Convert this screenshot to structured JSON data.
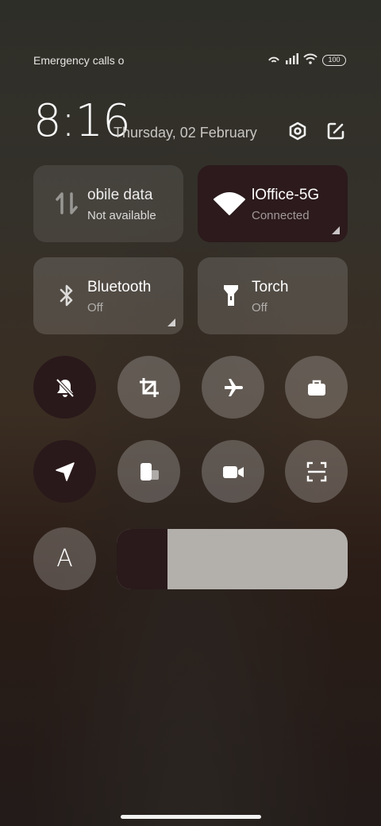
{
  "status_bar": {
    "carrier_text": "Emergency calls o",
    "battery_level": "100",
    "icons": [
      "hotspot-icon",
      "signal-icon",
      "wifi-icon",
      "battery-icon"
    ]
  },
  "header": {
    "time": "8:16",
    "date": "Thursday, 02 February",
    "actions": [
      "settings-icon",
      "edit-icon"
    ]
  },
  "tiles": {
    "mobile_data": {
      "title": "obile data",
      "subtitle": "Not available",
      "icon": "mobile-data-icon",
      "state": "unavailable"
    },
    "wifi": {
      "title": "lOffice-5G",
      "subtitle": "Connected",
      "icon": "wifi-icon",
      "state": "on"
    },
    "bluetooth": {
      "title": "Bluetooth",
      "subtitle": "Off",
      "icon": "bluetooth-icon",
      "state": "off"
    },
    "torch": {
      "title": "Torch",
      "subtitle": "Off",
      "icon": "flashlight-icon",
      "state": "off"
    }
  },
  "toggles": [
    {
      "name": "mute",
      "icon": "bell-off-icon",
      "state": "on"
    },
    {
      "name": "screenshot",
      "icon": "crop-icon",
      "state": "off"
    },
    {
      "name": "airplane-mode",
      "icon": "airplane-icon",
      "state": "off"
    },
    {
      "name": "work-profile",
      "icon": "briefcase-icon",
      "state": "off"
    },
    {
      "name": "location",
      "icon": "location-arrow-icon",
      "state": "on"
    },
    {
      "name": "floating-window",
      "icon": "floating-window-icon",
      "state": "off"
    },
    {
      "name": "screen-recorder",
      "icon": "video-camera-icon",
      "state": "off"
    },
    {
      "name": "scanner",
      "icon": "scan-icon",
      "state": "off"
    }
  ],
  "auto_brightness": {
    "label": "A",
    "state": "off"
  },
  "brightness": {
    "level": 0.22
  },
  "colors": {
    "active_tile": "#2c1a1c",
    "slider_track": "#b3b0ac"
  }
}
